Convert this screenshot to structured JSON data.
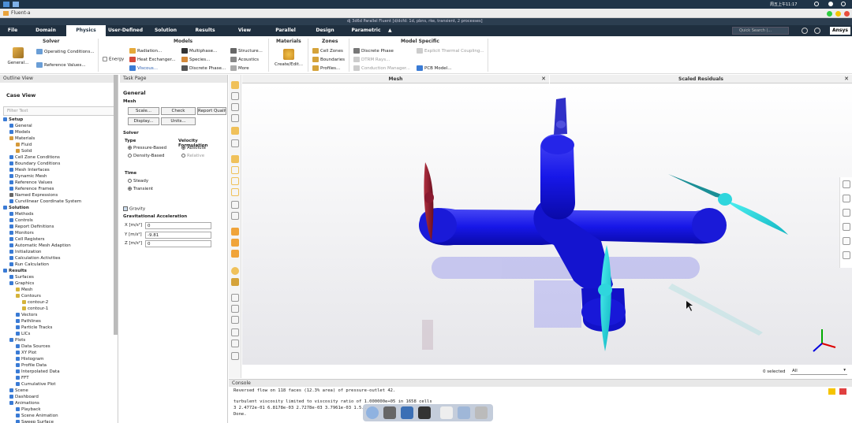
{
  "system": {
    "datetime": "周五上午11:17"
  },
  "window": {
    "title": "Fluent-a",
    "app_title": "dj 3d6d Parallel Fluent [d/dcfd: 1d, pbns, rke, transient, 2 processes]"
  },
  "menu": {
    "tabs": [
      "File",
      "Domain",
      "Physics",
      "User-Defined",
      "Solution",
      "Results",
      "View",
      "Parallel",
      "Design",
      "Parametric"
    ],
    "active": "Physics",
    "search_placeholder": "Quick Search (...",
    "brand": "Ansys"
  },
  "ribbon": {
    "solver": {
      "title": "Solver",
      "general": "General...",
      "operating": "Operating Conditions...",
      "reference": "Reference Values..."
    },
    "models": {
      "title": "Models",
      "energy": "Energy",
      "radiation": "Radiation...",
      "heat_exchanger": "Heat Exchanger...",
      "viscous": "Viscous...",
      "multiphase": "Multiphase...",
      "species": "Species...",
      "discrete_phase": "Discrete Phase...",
      "structure": "Structure...",
      "acoustics": "Acoustics",
      "more": "More"
    },
    "materials": {
      "title": "Materials",
      "create": "Create/Edit..."
    },
    "zones": {
      "title": "Zones",
      "cell": "Cell Zones",
      "boundaries": "Boundaries",
      "profiles": "Profiles..."
    },
    "model_specific": {
      "title": "Model Specific",
      "discrete_phase": "Discrete Phase",
      "dtrm": "DTRM Rays...",
      "conduction": "Conduction Manager...",
      "thermal": "Explicit Thermal Coupling...",
      "pcb": "PCB Model..."
    }
  },
  "outline": {
    "header": "Outline View",
    "case_view": "Case View",
    "filter_placeholder": "Filter Text",
    "tree": [
      {
        "label": "Setup",
        "lvl": 0,
        "hd": true,
        "c": "#3a7bd5"
      },
      {
        "label": "General",
        "lvl": 1,
        "c": "#3a7bd5"
      },
      {
        "label": "Models",
        "lvl": 1,
        "c": "#3a7bd5"
      },
      {
        "label": "Materials",
        "lvl": 1,
        "c": "#d59a3a"
      },
      {
        "label": "Fluid",
        "lvl": 2,
        "c": "#d59a3a"
      },
      {
        "label": "Solid",
        "lvl": 2,
        "c": "#d59a3a"
      },
      {
        "label": "Cell Zone Conditions",
        "lvl": 1,
        "c": "#3a7bd5"
      },
      {
        "label": "Boundary Conditions",
        "lvl": 1,
        "c": "#3a7bd5"
      },
      {
        "label": "Mesh Interfaces",
        "lvl": 1,
        "c": "#3a7bd5"
      },
      {
        "label": "Dynamic Mesh",
        "lvl": 1,
        "c": "#3a7bd5"
      },
      {
        "label": "Reference Values",
        "lvl": 1,
        "c": "#3a7bd5"
      },
      {
        "label": "Reference Frames",
        "lvl": 1,
        "c": "#3a7bd5"
      },
      {
        "label": "Named Expressions",
        "lvl": 1,
        "c": "#666"
      },
      {
        "label": "Curvilinear Coordinate System",
        "lvl": 1,
        "c": "#3a7bd5"
      },
      {
        "label": "Solution",
        "lvl": 0,
        "hd": true,
        "c": "#3a7bd5"
      },
      {
        "label": "Methods",
        "lvl": 1,
        "c": "#3a7bd5"
      },
      {
        "label": "Controls",
        "lvl": 1,
        "c": "#3a7bd5"
      },
      {
        "label": "Report Definitions",
        "lvl": 1,
        "c": "#3a7bd5"
      },
      {
        "label": "Monitors",
        "lvl": 1,
        "c": "#3a7bd5"
      },
      {
        "label": "Cell Registers",
        "lvl": 1,
        "c": "#3a7bd5"
      },
      {
        "label": "Automatic Mesh Adaption",
        "lvl": 1,
        "c": "#3a7bd5"
      },
      {
        "label": "Initialization",
        "lvl": 1,
        "c": "#3a7bd5"
      },
      {
        "label": "Calculation Activities",
        "lvl": 1,
        "c": "#3a7bd5"
      },
      {
        "label": "Run Calculation",
        "lvl": 1,
        "c": "#3a7bd5"
      },
      {
        "label": "Results",
        "lvl": 0,
        "hd": true,
        "c": "#3a7bd5"
      },
      {
        "label": "Surfaces",
        "lvl": 1,
        "c": "#3a7bd5"
      },
      {
        "label": "Graphics",
        "lvl": 1,
        "c": "#3a7bd5"
      },
      {
        "label": "Mesh",
        "lvl": 2,
        "c": "#d5b33a"
      },
      {
        "label": "Contours",
        "lvl": 2,
        "c": "#d5b33a"
      },
      {
        "label": "contour-2",
        "lvl": 3,
        "c": "#d5b33a"
      },
      {
        "label": "contour-1",
        "lvl": 3,
        "c": "#d5b33a"
      },
      {
        "label": "Vectors",
        "lvl": 2,
        "c": "#3a7bd5"
      },
      {
        "label": "Pathlines",
        "lvl": 2,
        "c": "#3a7bd5"
      },
      {
        "label": "Particle Tracks",
        "lvl": 2,
        "c": "#3a7bd5"
      },
      {
        "label": "LICs",
        "lvl": 2,
        "c": "#3a7bd5"
      },
      {
        "label": "Plots",
        "lvl": 1,
        "c": "#3a7bd5"
      },
      {
        "label": "Data Sources",
        "lvl": 2,
        "c": "#3a7bd5"
      },
      {
        "label": "XY Plot",
        "lvl": 2,
        "c": "#3a7bd5"
      },
      {
        "label": "Histogram",
        "lvl": 2,
        "c": "#3a7bd5"
      },
      {
        "label": "Profile Data",
        "lvl": 2,
        "c": "#3a7bd5"
      },
      {
        "label": "Interpolated Data",
        "lvl": 2,
        "c": "#3a7bd5"
      },
      {
        "label": "FFT",
        "lvl": 2,
        "c": "#3a7bd5"
      },
      {
        "label": "Cumulative Plot",
        "lvl": 2,
        "c": "#3a7bd5"
      },
      {
        "label": "Scene",
        "lvl": 1,
        "c": "#3a7bd5"
      },
      {
        "label": "Dashboard",
        "lvl": 1,
        "c": "#3a7bd5"
      },
      {
        "label": "Animations",
        "lvl": 1,
        "c": "#3a7bd5"
      },
      {
        "label": "Playback",
        "lvl": 2,
        "c": "#3a7bd5"
      },
      {
        "label": "Scene Animation",
        "lvl": 2,
        "c": "#3a7bd5"
      },
      {
        "label": "Sweep Surface",
        "lvl": 2,
        "c": "#3a7bd5"
      }
    ]
  },
  "task": {
    "header": "Task Page",
    "title": "General",
    "mesh_label": "Mesh",
    "buttons": [
      "Scale...",
      "Check",
      "Report Quality",
      "Display...",
      "Units..."
    ],
    "solver_label": "Solver",
    "type_label": "Type",
    "type_options": [
      "Pressure-Based",
      "Density-Based"
    ],
    "velocity_label": "Velocity Formulation",
    "velocity_options": [
      "Absolute",
      "Relative"
    ],
    "time_label": "Time",
    "time_options": [
      "Steady",
      "Transient"
    ],
    "gravity": "Gravity",
    "grav_label": "Gravitational Acceleration",
    "grav_x_label": "X [m/s²]",
    "grav_x": "0",
    "grav_y_label": "Y [m/s²]",
    "grav_y": "-9.81",
    "grav_z_label": "Z [m/s²]",
    "grav_z": "0"
  },
  "panes": {
    "mesh_title": "Mesh",
    "resid_title": "Scaled Residuals",
    "selected": "0 selected",
    "select_option": "All"
  },
  "console": {
    "header": "Console",
    "lines": [
      "Reversed flow on 118 faces (12.3% area) of pressure-outlet 42.",
      "turbulent viscosity limited to viscosity ratio of 1.000000e+05 in 1658 cells",
      "  3  2.4772e-01  6.8178e-03  2.7278e-03  3.7961e-03  1.5...",
      "Done."
    ]
  }
}
